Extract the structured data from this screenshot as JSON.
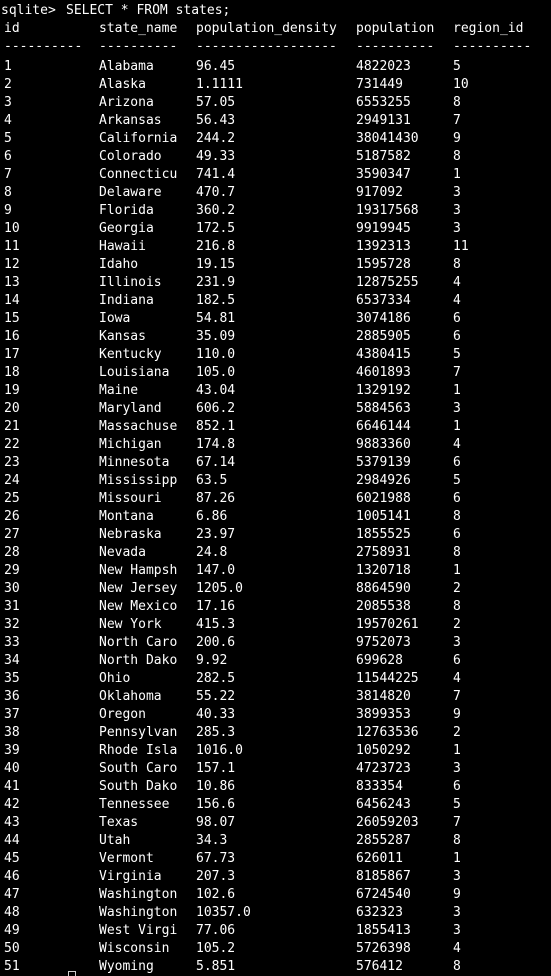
{
  "terminal": {
    "prompt": "sqlite> ",
    "command": "SELECT * FROM states;",
    "columns": [
      "id",
      "state_name",
      "population_density",
      "population",
      "region_id"
    ],
    "separators": [
      "----------",
      "----------",
      "------------------",
      "----------",
      "----------"
    ],
    "rows": [
      [
        "1",
        "Alabama",
        "96.45",
        "4822023",
        "5"
      ],
      [
        "2",
        "Alaska",
        "1.1111",
        "731449",
        "10"
      ],
      [
        "3",
        "Arizona",
        "57.05",
        "6553255",
        "8"
      ],
      [
        "4",
        "Arkansas",
        "56.43",
        "2949131",
        "7"
      ],
      [
        "5",
        "California",
        "244.2",
        "38041430",
        "9"
      ],
      [
        "6",
        "Colorado",
        "49.33",
        "5187582",
        "8"
      ],
      [
        "7",
        "Connecticu",
        "741.4",
        "3590347",
        "1"
      ],
      [
        "8",
        "Delaware",
        "470.7",
        "917092",
        "3"
      ],
      [
        "9",
        "Florida",
        "360.2",
        "19317568",
        "3"
      ],
      [
        "10",
        "Georgia",
        "172.5",
        "9919945",
        "3"
      ],
      [
        "11",
        "Hawaii",
        "216.8",
        "1392313",
        "11"
      ],
      [
        "12",
        "Idaho",
        "19.15",
        "1595728",
        "8"
      ],
      [
        "13",
        "Illinois",
        "231.9",
        "12875255",
        "4"
      ],
      [
        "14",
        "Indiana",
        "182.5",
        "6537334",
        "4"
      ],
      [
        "15",
        "Iowa",
        "54.81",
        "3074186",
        "6"
      ],
      [
        "16",
        "Kansas",
        "35.09",
        "2885905",
        "6"
      ],
      [
        "17",
        "Kentucky",
        "110.0",
        "4380415",
        "5"
      ],
      [
        "18",
        "Louisiana",
        "105.0",
        "4601893",
        "7"
      ],
      [
        "19",
        "Maine",
        "43.04",
        "1329192",
        "1"
      ],
      [
        "20",
        "Maryland",
        "606.2",
        "5884563",
        "3"
      ],
      [
        "21",
        "Massachuse",
        "852.1",
        "6646144",
        "1"
      ],
      [
        "22",
        "Michigan",
        "174.8",
        "9883360",
        "4"
      ],
      [
        "23",
        "Minnesota",
        "67.14",
        "5379139",
        "6"
      ],
      [
        "24",
        "Mississipp",
        "63.5",
        "2984926",
        "5"
      ],
      [
        "25",
        "Missouri",
        "87.26",
        "6021988",
        "6"
      ],
      [
        "26",
        "Montana",
        "6.86",
        "1005141",
        "8"
      ],
      [
        "27",
        "Nebraska",
        "23.97",
        "1855525",
        "6"
      ],
      [
        "28",
        "Nevada",
        "24.8",
        "2758931",
        "8"
      ],
      [
        "29",
        "New Hampsh",
        "147.0",
        "1320718",
        "1"
      ],
      [
        "30",
        "New Jersey",
        "1205.0",
        "8864590",
        "2"
      ],
      [
        "31",
        "New Mexico",
        "17.16",
        "2085538",
        "8"
      ],
      [
        "32",
        "New York",
        "415.3",
        "19570261",
        "2"
      ],
      [
        "33",
        "North Caro",
        "200.6",
        "9752073",
        "3"
      ],
      [
        "34",
        "North Dako",
        "9.92",
        "699628",
        "6"
      ],
      [
        "35",
        "Ohio",
        "282.5",
        "11544225",
        "4"
      ],
      [
        "36",
        "Oklahoma",
        "55.22",
        "3814820",
        "7"
      ],
      [
        "37",
        "Oregon",
        "40.33",
        "3899353",
        "9"
      ],
      [
        "38",
        "Pennsylvan",
        "285.3",
        "12763536",
        "2"
      ],
      [
        "39",
        "Rhode Isla",
        "1016.0",
        "1050292",
        "1"
      ],
      [
        "40",
        "South Caro",
        "157.1",
        "4723723",
        "3"
      ],
      [
        "41",
        "South Dako",
        "10.86",
        "833354",
        "6"
      ],
      [
        "42",
        "Tennessee",
        "156.6",
        "6456243",
        "5"
      ],
      [
        "43",
        "Texas",
        "98.07",
        "26059203",
        "7"
      ],
      [
        "44",
        "Utah",
        "34.3",
        "2855287",
        "8"
      ],
      [
        "45",
        "Vermont",
        "67.73",
        "626011",
        "1"
      ],
      [
        "46",
        "Virginia",
        "207.3",
        "8185867",
        "3"
      ],
      [
        "47",
        "Washington",
        "102.6",
        "6724540",
        "9"
      ],
      [
        "48",
        "Washington",
        "10357.0",
        "632323",
        "3"
      ],
      [
        "49",
        "West Virgi",
        "77.06",
        "1855413",
        "3"
      ],
      [
        "50",
        "Wisconsin",
        "105.2",
        "5726398",
        "4"
      ],
      [
        "51",
        "Wyoming",
        "5.851",
        "576412",
        "8"
      ]
    ]
  }
}
